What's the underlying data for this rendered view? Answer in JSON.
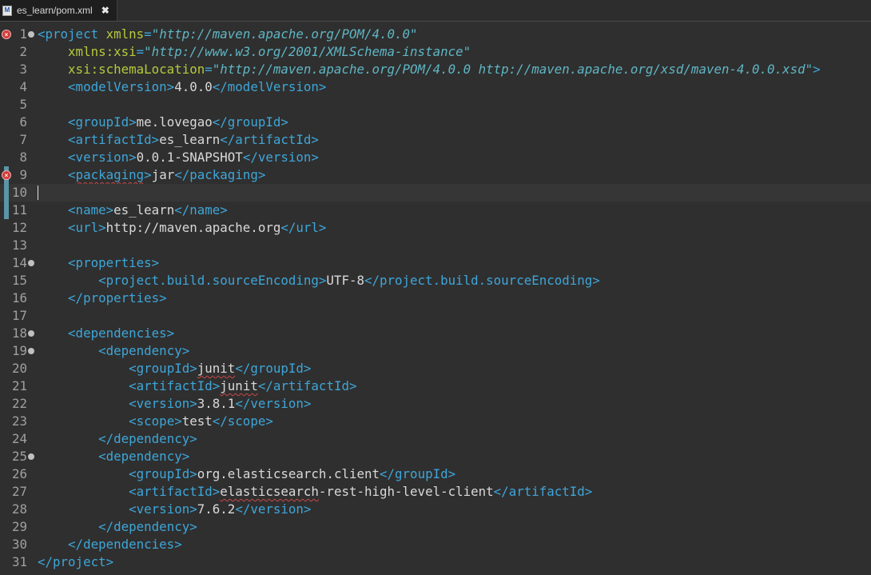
{
  "tab": {
    "icon_letter": "M",
    "title": "es_learn/pom.xml",
    "close": "✖"
  },
  "editor": {
    "current_line": 10,
    "error_lines": [
      1,
      9
    ],
    "folded_lines": [
      1,
      14,
      18,
      19,
      25
    ],
    "changed_lines": [
      9,
      10,
      11
    ],
    "lines": [
      [
        [
          "tag",
          "<project "
        ],
        [
          "attr",
          "xmlns"
        ],
        [
          "tag",
          "="
        ],
        [
          "val",
          "\"http://maven.apache.org/POM/4.0.0\""
        ]
      ],
      [
        [
          "txt",
          "    "
        ],
        [
          "attr",
          "xmlns:xsi"
        ],
        [
          "tag",
          "="
        ],
        [
          "val",
          "\"http://www.w3.org/2001/XMLSchema-instance\""
        ]
      ],
      [
        [
          "txt",
          "    "
        ],
        [
          "attr",
          "xsi:schemaLocation"
        ],
        [
          "tag",
          "="
        ],
        [
          "val",
          "\"http://maven.apache.org/POM/4.0.0 http://maven.apache.org/xsd/maven-4.0.0.xsd\""
        ],
        [
          "tag",
          ">"
        ]
      ],
      [
        [
          "txt",
          "    "
        ],
        [
          "tag",
          "<modelVersion>"
        ],
        [
          "txt",
          "4.0.0"
        ],
        [
          "tag",
          "</modelVersion>"
        ]
      ],
      [],
      [
        [
          "txt",
          "    "
        ],
        [
          "tag",
          "<groupId>"
        ],
        [
          "txt",
          "me.lovegao"
        ],
        [
          "tag",
          "</groupId>"
        ]
      ],
      [
        [
          "txt",
          "    "
        ],
        [
          "tag",
          "<artifactId>"
        ],
        [
          "txt",
          "es_learn"
        ],
        [
          "tag",
          "</artifactId>"
        ]
      ],
      [
        [
          "txt",
          "    "
        ],
        [
          "tag",
          "<version>"
        ],
        [
          "txt",
          "0.0.1-SNAPSHOT"
        ],
        [
          "tag",
          "</version>"
        ]
      ],
      [
        [
          "txt",
          "    "
        ],
        [
          "tag",
          "<"
        ],
        [
          "tag squig",
          "packaging"
        ],
        [
          "tag",
          ">"
        ],
        [
          "txt",
          "jar"
        ],
        [
          "tag",
          "</packaging>"
        ]
      ],
      [],
      [
        [
          "txt",
          "    "
        ],
        [
          "tag",
          "<name>"
        ],
        [
          "txt",
          "es_learn"
        ],
        [
          "tag",
          "</name>"
        ]
      ],
      [
        [
          "txt",
          "    "
        ],
        [
          "tag",
          "<url>"
        ],
        [
          "txt",
          "http://maven.apache.org"
        ],
        [
          "tag",
          "</url>"
        ]
      ],
      [],
      [
        [
          "txt",
          "    "
        ],
        [
          "tag",
          "<properties>"
        ]
      ],
      [
        [
          "txt",
          "        "
        ],
        [
          "tag",
          "<project.build.sourceEncoding>"
        ],
        [
          "txt",
          "UTF-8"
        ],
        [
          "tag",
          "</project.build.sourceEncoding>"
        ]
      ],
      [
        [
          "txt",
          "    "
        ],
        [
          "tag",
          "</properties>"
        ]
      ],
      [],
      [
        [
          "txt",
          "    "
        ],
        [
          "tag",
          "<dependencies>"
        ]
      ],
      [
        [
          "txt",
          "        "
        ],
        [
          "tag",
          "<dependency>"
        ]
      ],
      [
        [
          "txt",
          "            "
        ],
        [
          "tag",
          "<groupId>"
        ],
        [
          "txt squig",
          "junit"
        ],
        [
          "tag",
          "</groupId>"
        ]
      ],
      [
        [
          "txt",
          "            "
        ],
        [
          "tag",
          "<artifactId>"
        ],
        [
          "txt squig",
          "junit"
        ],
        [
          "tag",
          "</artifactId>"
        ]
      ],
      [
        [
          "txt",
          "            "
        ],
        [
          "tag",
          "<version>"
        ],
        [
          "txt",
          "3.8.1"
        ],
        [
          "tag",
          "</version>"
        ]
      ],
      [
        [
          "txt",
          "            "
        ],
        [
          "tag",
          "<scope>"
        ],
        [
          "txt",
          "test"
        ],
        [
          "tag",
          "</scope>"
        ]
      ],
      [
        [
          "txt",
          "        "
        ],
        [
          "tag",
          "</dependency>"
        ]
      ],
      [
        [
          "txt",
          "        "
        ],
        [
          "tag",
          "<dependency>"
        ]
      ],
      [
        [
          "txt",
          "            "
        ],
        [
          "tag",
          "<groupId>"
        ],
        [
          "txt",
          "org.elasticsearch.client"
        ],
        [
          "tag",
          "</groupId>"
        ]
      ],
      [
        [
          "txt",
          "            "
        ],
        [
          "tag",
          "<artifactId>"
        ],
        [
          "txt squig",
          "elasticsearch"
        ],
        [
          "txt",
          "-rest-high-level-client"
        ],
        [
          "tag",
          "</artifactId>"
        ]
      ],
      [
        [
          "txt",
          "            "
        ],
        [
          "tag",
          "<version>"
        ],
        [
          "txt",
          "7.6.2"
        ],
        [
          "tag",
          "</version>"
        ]
      ],
      [
        [
          "txt",
          "        "
        ],
        [
          "tag",
          "</dependency>"
        ]
      ],
      [
        [
          "txt",
          "    "
        ],
        [
          "tag",
          "</dependencies>"
        ]
      ],
      [
        [
          "tag",
          "</project>"
        ]
      ]
    ]
  }
}
